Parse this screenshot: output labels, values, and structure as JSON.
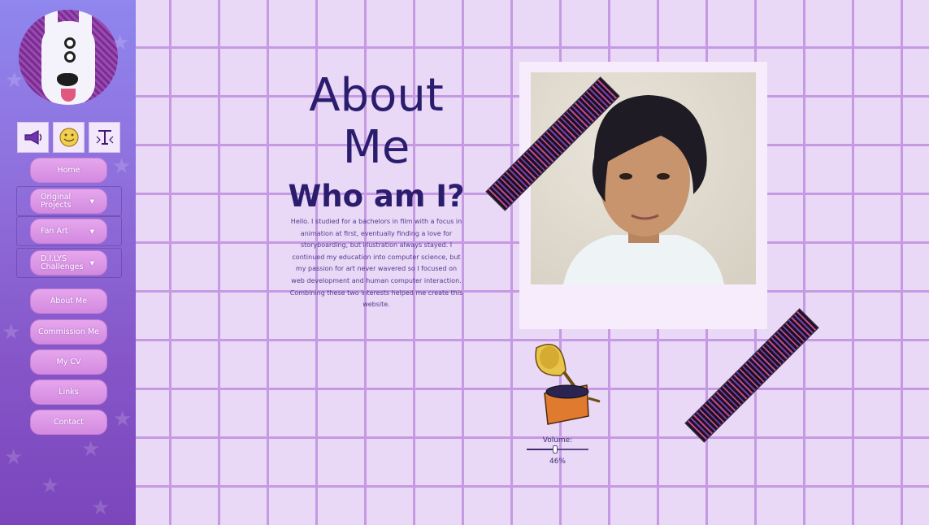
{
  "sidebar": {
    "icons": [
      "megaphone-icon",
      "emoji-icon",
      "text-size-icon"
    ],
    "items": [
      {
        "label": "Home"
      },
      {
        "label": "Original Projects",
        "dropdown": true
      },
      {
        "label": "Fan Art",
        "dropdown": true
      },
      {
        "label": "D.I.LYS Challenges",
        "dropdown": true
      },
      {
        "label": "About Me"
      },
      {
        "label": "Commission Me"
      },
      {
        "label": "My CV"
      },
      {
        "label": "Links"
      },
      {
        "label": "Contact"
      }
    ]
  },
  "main": {
    "title": "About Me",
    "subtitle": "Who am I?",
    "bio": "Hello. I studied for a bachelors in film with a focus in animation at first, eventually finding a love for storyboarding, but illustration always stayed. I continued my education into computer science, but my passion for art never wavered so I focused on web development and human computer interaction. Combining these two interests helped me create this website."
  },
  "volume": {
    "label": "Volume:",
    "value_text": "46%",
    "level": 0.46
  },
  "colors": {
    "accent": "#8555c8",
    "grid": "#c59ae3",
    "background": "#ead8f7",
    "text": "#2b1d6e",
    "tape": "#c6458f"
  }
}
